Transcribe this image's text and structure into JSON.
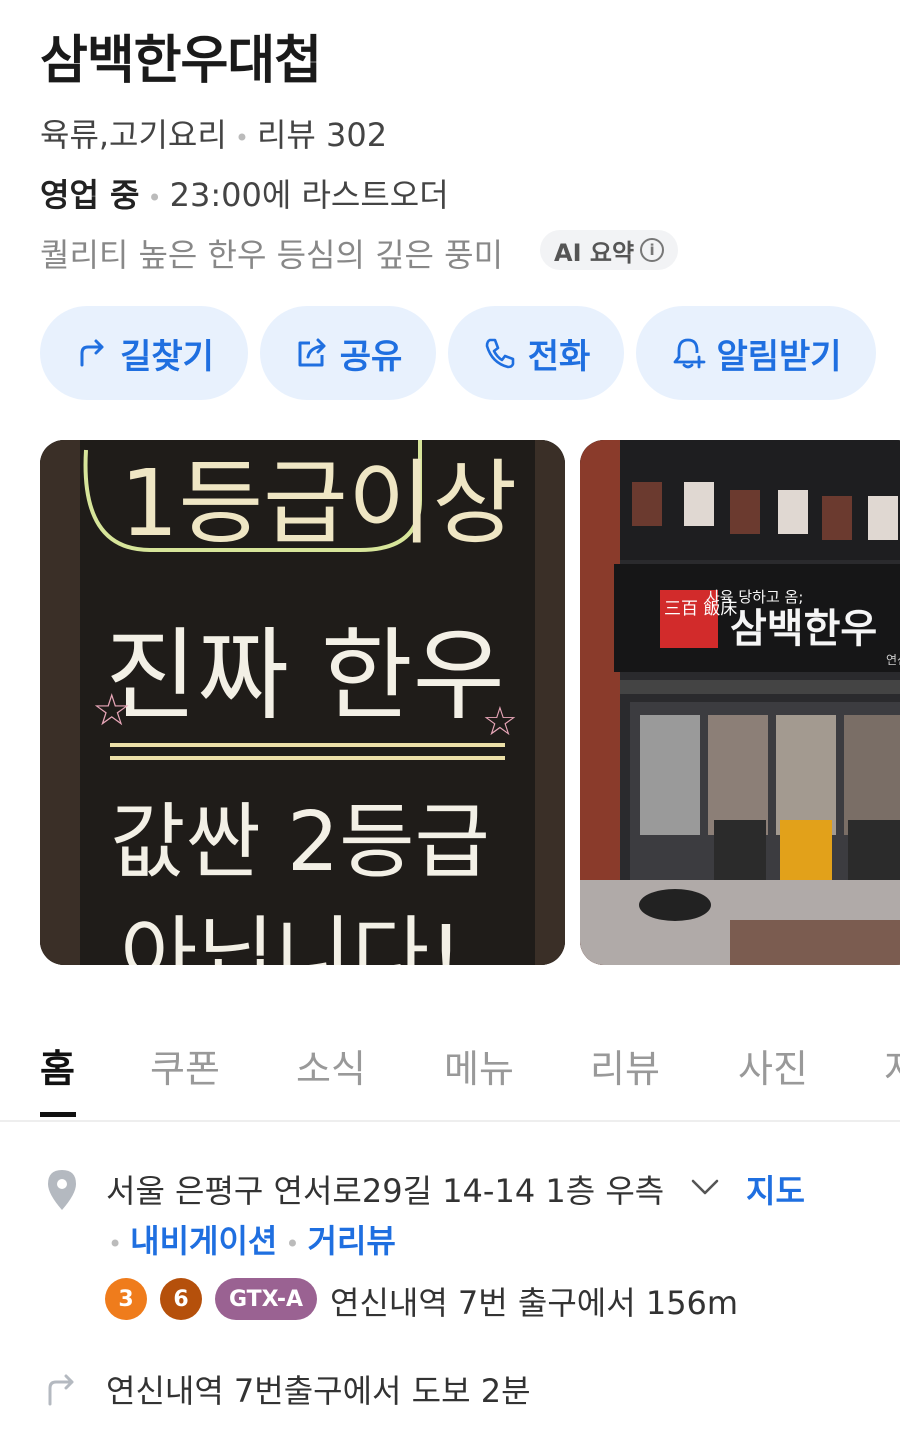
{
  "place": {
    "title": "삼백한우대첩",
    "category": "육류,고기요리",
    "review_label": "리뷰 302",
    "status": "영업 중",
    "last_order": "23:00에 라스트오더",
    "summary": "퀄리티 높은 한우 등심의 깊은 풍미",
    "ai_badge": "AI 요약",
    "ai_info_glyph": "i"
  },
  "actions": [
    {
      "label": "길찾기",
      "icon": "directions-icon"
    },
    {
      "label": "공유",
      "icon": "share-icon"
    },
    {
      "label": "전화",
      "icon": "phone-icon"
    },
    {
      "label": "알림받기",
      "icon": "bell-plus-icon"
    }
  ],
  "photos": {
    "sign": {
      "line1": "1등급이상",
      "line2": "진짜 한우",
      "line3": "값싼 2등급",
      "line4": "아닙니다!"
    },
    "storefront": {
      "hanja": "三百 飯床",
      "small_text": "사육 당하고 옴;",
      "sign_text": "삼백한우",
      "sign_corner": "연신"
    }
  },
  "tabs": [
    {
      "label": "홈",
      "active": true
    },
    {
      "label": "쿠폰",
      "active": false
    },
    {
      "label": "소식",
      "active": false
    },
    {
      "label": "메뉴",
      "active": false
    },
    {
      "label": "리뷰",
      "active": false
    },
    {
      "label": "사진",
      "active": false
    },
    {
      "label": "저",
      "active": false
    }
  ],
  "location": {
    "address": "서울 은평구 연서로29길 14-14 1층 우측",
    "map_link": "지도",
    "navigation_link": "내비게이션",
    "street_view_link": "거리뷰",
    "subway_lines": [
      {
        "label": "3",
        "color": "#ef7c1c"
      },
      {
        "label": "6",
        "color": "#b5500b"
      },
      {
        "label": "GTX-A",
        "color": "#9a6292"
      }
    ],
    "station_text": "연신내역 7번 출구에서 156m",
    "walking_text": "연신내역 7번출구에서 도보 2분"
  },
  "colors": {
    "accent": "#1f6fe0",
    "button_bg": "#e8f1fd"
  }
}
